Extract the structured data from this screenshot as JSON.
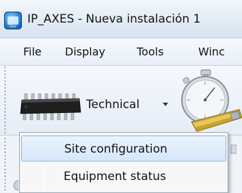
{
  "window": {
    "title": "IP_AXES - Nueva instalación 1",
    "icon": "ip-axes-app-icon",
    "icon_caption": "Axes"
  },
  "menubar": {
    "items": [
      {
        "label": "File"
      },
      {
        "label": "Display"
      },
      {
        "label": "Tools"
      },
      {
        "label": "Winc"
      }
    ]
  },
  "toolbar": {
    "technical": {
      "label": "Technical",
      "icon": "chip-icon",
      "has_dropdown": true
    },
    "stopwatch": {
      "icon": "stopwatch-icon"
    }
  },
  "dropdown": {
    "items": [
      {
        "label": "Site configuration",
        "highlighted": true
      },
      {
        "label": "Equipment status",
        "highlighted": false
      }
    ]
  },
  "colors": {
    "menu_highlight_border": "#84b2e6",
    "menu_highlight_fill": "#d5e7fb",
    "titlebar": "#e3ecf5",
    "toolbar": "#e6edf6"
  }
}
